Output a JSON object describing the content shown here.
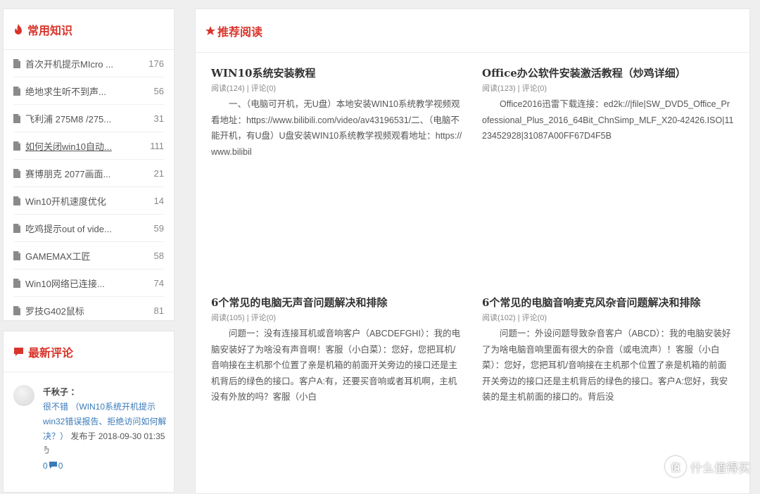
{
  "sidebar": {
    "knowledge": {
      "title": "常用知识",
      "icon": "flame-icon",
      "items": [
        {
          "label": "首次开机提示MIcro ...",
          "count": "176"
        },
        {
          "label": "绝地求生听不到声...",
          "count": "56"
        },
        {
          "label": "飞利浦 275M8 /275...",
          "count": "31"
        },
        {
          "label": "如何关闭win10自动...",
          "count": "111"
        },
        {
          "label": "赛博朋克 2077画面...",
          "count": "21"
        },
        {
          "label": "Win10开机速度优化",
          "count": "14"
        },
        {
          "label": "吃鸡提示out of vide...",
          "count": "59"
        },
        {
          "label": "GAMEMAX工匠",
          "count": "58"
        },
        {
          "label": "Win10网络已连接...",
          "count": "74"
        },
        {
          "label": "罗技G402鼠标",
          "count": "81"
        }
      ]
    },
    "comments": {
      "title": "最新评论",
      "icon": "comment-icon",
      "items": [
        {
          "user": "千秋子 ：",
          "text": "很不错 （WIN10系统开机提示win32错误报告、拒绝访问如何解决？）",
          "meta": "发布于 2018-09-30 01:35",
          "likes": "0",
          "replies": "0"
        }
      ]
    }
  },
  "recommend": {
    "title": "推荐阅读",
    "icon": "star-icon",
    "articles": [
      {
        "title": "WIN10系统安装教程",
        "meta": "阅读(124) | 评论(0)",
        "body": "一、（电脑可开机，无U盘）本地安装WIN10系统教学视频观看地址：https://www.bilibili.com/video/av43196531/二、（电脑不能开机，有U盘）U盘安装WIN10系统教学视频观看地址：https://www.bilibil"
      },
      {
        "title": "Office办公软件安装激活教程（炒鸡详细）",
        "meta": "阅读(123) | 评论(0)",
        "body": "Office2016迅雷下载连接：ed2k://|file|SW_DVD5_Office_Professional_Plus_2016_64Bit_ChnSimp_MLF_X20-42426.ISO|1123452928|31087A00FF67D4F5B"
      },
      {
        "title": "6个常见的电脑无声音问题解决和排除",
        "meta": "阅读(105) | 评论(0)",
        "body": "问题一：没有连接耳机或音响客户（ABCDEFGHI）：我的电脑安装好了为啥没有声音啊！客服（小白菜）：您好，您把耳机/音响接在主机那个位置了亲是机箱的前面开关旁边的接口还是主机背后的绿色的接口。客户A:有，还要买音响或者耳机啊，主机没有外放的吗？客服（小白"
      },
      {
        "title": "6个常见的电脑音响麦克风杂音问题解决和排除",
        "meta": "阅读(102) | 评论(0)",
        "body": "问题一：外设问题导致杂音客户（ABCD）：我的电脑安装好了为啥电脑音响里面有很大的杂音（或电流声）！客服（小白菜）：您好，您把耳机/音响接在主机那个位置了亲是机箱的前面开关旁边的接口还是主机背后的绿色的接口。客户A:您好，我安装的是主机前面的接口的。背后没"
      }
    ]
  },
  "watermark": {
    "logo_char": "值",
    "text": "什么值得买"
  },
  "colors": {
    "accent": "#d9342b",
    "link": "#3a7ab8"
  }
}
